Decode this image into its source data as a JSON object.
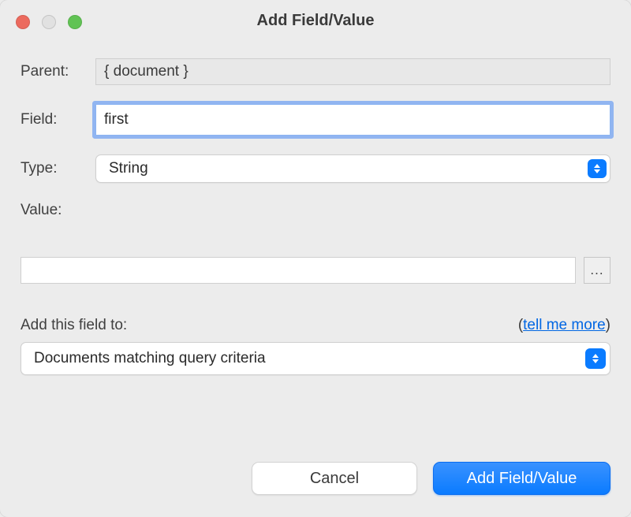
{
  "title": "Add Field/Value",
  "labels": {
    "parent": "Parent:",
    "field": "Field:",
    "type": "Type:",
    "value": "Value:",
    "add_to": "Add this field to:"
  },
  "parent_value": "{ document }",
  "field_value": "first",
  "type_options": {
    "selected": "String"
  },
  "value_value": "",
  "more_button": "...",
  "tell_me_more": {
    "prefix": "(",
    "link": "tell me more",
    "suffix": ")"
  },
  "scope_options": {
    "selected": "Documents matching query criteria"
  },
  "buttons": {
    "cancel": "Cancel",
    "submit": "Add Field/Value"
  }
}
